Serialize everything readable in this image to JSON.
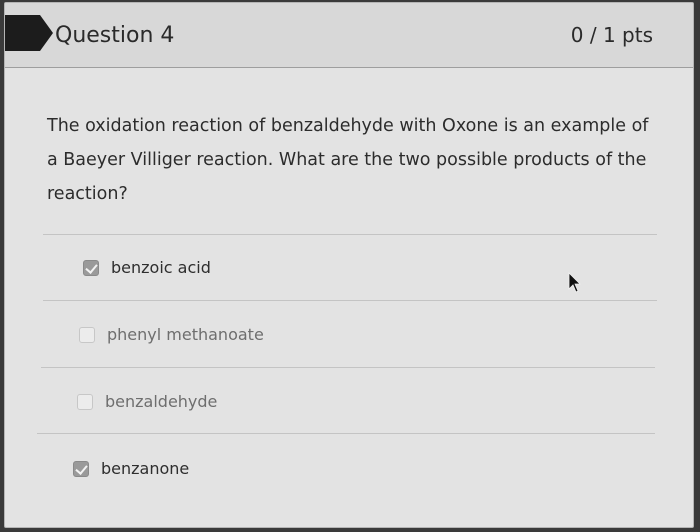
{
  "question": {
    "title": "Question 4",
    "points": "0 / 1 pts",
    "text": "The oxidation reaction of benzaldehyde with Oxone is an example of a Baeyer Villiger reaction. What are the two possible products of the reaction?"
  },
  "answers": [
    {
      "label": "benzoic acid",
      "checked": true
    },
    {
      "label": "phenyl methanoate",
      "checked": false
    },
    {
      "label": "benzaldehyde",
      "checked": false
    },
    {
      "label": "benzanone",
      "checked": true
    }
  ]
}
